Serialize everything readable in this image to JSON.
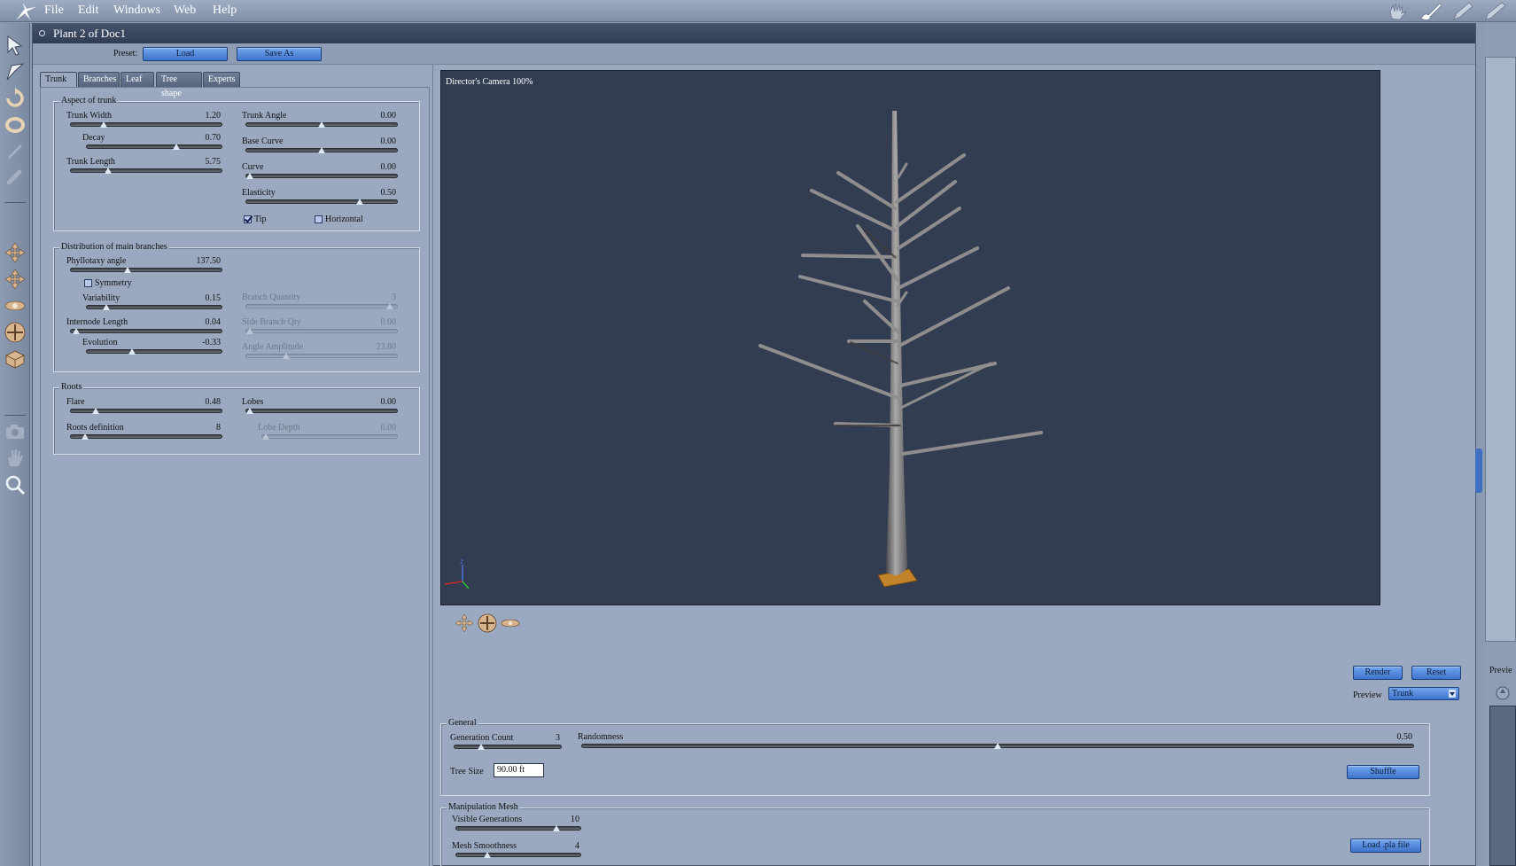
{
  "menu": [
    "File",
    "Edit",
    "Windows",
    "Web",
    "Help"
  ],
  "window": {
    "title": "Plant 2 of Doc1"
  },
  "preset": {
    "label": "Preset:",
    "load": "Load",
    "save_as": "Save As"
  },
  "tabs": [
    "Trunk",
    "Branches",
    "Leaf",
    "Tree shape",
    "Experts"
  ],
  "aspect": {
    "title": "Aspect of trunk",
    "trunk_width": {
      "label": "Trunk Width",
      "value": "1.20",
      "pos": 0.22
    },
    "decay": {
      "label": "Decay",
      "value": "0.70",
      "pos": 0.66
    },
    "trunk_length": {
      "label": "Trunk Length",
      "value": "5.75",
      "pos": 0.25
    },
    "trunk_angle": {
      "label": "Trunk Angle",
      "value": "0.00",
      "pos": 0.5
    },
    "base_curve": {
      "label": "Base Curve",
      "value": "0.00",
      "pos": 0.5
    },
    "curve": {
      "label": "Curve",
      "value": "0.00",
      "pos": 0.03
    },
    "elasticity": {
      "label": "Elasticity",
      "value": "0.50",
      "pos": 0.75
    },
    "tip": {
      "label": "Tip",
      "checked": true
    },
    "horizontal": {
      "label": "Horizontal",
      "checked": false
    }
  },
  "distribution": {
    "title": "Distribution of main branches",
    "phyllotaxy": {
      "label": "Phyllotaxy angle",
      "value": "137.50",
      "pos": 0.38
    },
    "symmetry": {
      "label": "Symmetry",
      "checked": false
    },
    "variability": {
      "label": "Variability",
      "value": "0.15",
      "pos": 0.15
    },
    "internode": {
      "label": "Internode Length",
      "value": "0.04",
      "pos": 0.04
    },
    "evolution": {
      "label": "Evolution",
      "value": "-0.33",
      "pos": 0.34
    },
    "branch_qty": {
      "label": "Branch Quantity",
      "value": "3",
      "pos": 0.95
    },
    "side_branch": {
      "label": "Side Branch Qty",
      "value": "0.00",
      "pos": 0.03
    },
    "angle_amp": {
      "label": "Angle Amplitude",
      "value": "23.80",
      "pos": 0.27
    }
  },
  "roots": {
    "title": "Roots",
    "flare": {
      "label": "Flare",
      "value": "0.48",
      "pos": 0.17
    },
    "roots_def": {
      "label": "Roots definition",
      "value": "8",
      "pos": 0.1
    },
    "lobes": {
      "label": "Lobes",
      "value": "0.00",
      "pos": 0.03
    },
    "lobe_depth": {
      "label": "Lobe Depth",
      "value": "0.00",
      "pos": 0.03
    }
  },
  "viewport": {
    "camera": "Director's Camera 100%"
  },
  "actions": {
    "render": "Render",
    "reset": "Reset",
    "preview_label": "Preview",
    "preview_value": "Trunk"
  },
  "general": {
    "title": "General",
    "generation_count": {
      "label": "Generation Count",
      "value": "3",
      "pos": 0.25
    },
    "randomness": {
      "label": "Randomness",
      "value": "0.50",
      "pos": 0.5
    },
    "tree_size_label": "Tree Size",
    "tree_size": "90.00 ft",
    "shuffle": "Shuffle"
  },
  "mesh": {
    "title": "Manipulation Mesh",
    "visible_generations": {
      "label": "Visible Generations",
      "value": "10",
      "pos": 0.8
    },
    "mesh_smoothness": {
      "label": "Mesh Smoothness",
      "value": "4",
      "pos": 0.25
    },
    "load_pla": "Load .pla file"
  },
  "right_panel": {
    "preview_label": "Previe"
  },
  "icons": {
    "toolbar": [
      "arrow-select-icon",
      "rotate-select-icon",
      "rotate-icon",
      "twist-icon",
      "scale-icon",
      "link-icon",
      "move-xy-icon",
      "move-xz-icon",
      "move-yz-icon",
      "trackball-icon",
      "surface-icon",
      "camera-icon",
      "hand-icon",
      "zoom-icon"
    ],
    "top_right": [
      "hand-tool-icon",
      "brush-icon",
      "pen-icon",
      "pencil-icon"
    ]
  },
  "colors": {
    "accent": "#3d73cc",
    "viewport": "#323d51",
    "panel": "#9aa9bf",
    "title_bar": "#34435a"
  }
}
